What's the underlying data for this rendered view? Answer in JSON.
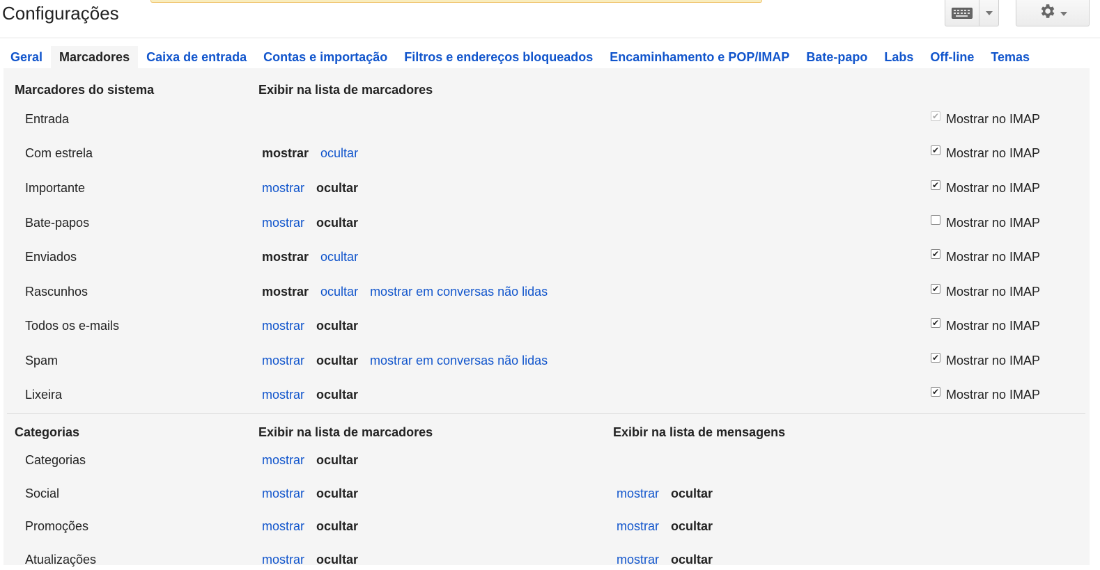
{
  "header": {
    "title": "Configurações"
  },
  "tabs": [
    {
      "label": "Geral",
      "active": false
    },
    {
      "label": "Marcadores",
      "active": true
    },
    {
      "label": "Caixa de entrada",
      "active": false
    },
    {
      "label": "Contas e importação",
      "active": false
    },
    {
      "label": "Filtros e endereços bloqueados",
      "active": false
    },
    {
      "label": "Encaminhamento e POP/IMAP",
      "active": false
    },
    {
      "label": "Bate-papo",
      "active": false
    },
    {
      "label": "Labs",
      "active": false
    },
    {
      "label": "Off-line",
      "active": false
    },
    {
      "label": "Temas",
      "active": false
    }
  ],
  "system": {
    "heading": "Marcadores do sistema",
    "col_heading": "Exibir na lista de marcadores",
    "show_label": "mostrar",
    "hide_label": "ocultar",
    "unread_label": "mostrar em conversas não lidas",
    "imap_label": "Mostrar no IMAP",
    "rows": [
      {
        "name": "Entrada",
        "state": null,
        "unread_option": false,
        "imap_checked": true,
        "imap_disabled": true
      },
      {
        "name": "Com estrela",
        "state": "mostrar",
        "unread_option": false,
        "imap_checked": true,
        "imap_disabled": false
      },
      {
        "name": "Importante",
        "state": "ocultar",
        "unread_option": false,
        "imap_checked": true,
        "imap_disabled": false
      },
      {
        "name": "Bate-papos",
        "state": "ocultar",
        "unread_option": false,
        "imap_checked": false,
        "imap_disabled": false
      },
      {
        "name": "Enviados",
        "state": "mostrar",
        "unread_option": false,
        "imap_checked": true,
        "imap_disabled": false
      },
      {
        "name": "Rascunhos",
        "state": "mostrar",
        "unread_option": true,
        "imap_checked": true,
        "imap_disabled": false
      },
      {
        "name": "Todos os e-mails",
        "state": "ocultar",
        "unread_option": false,
        "imap_checked": true,
        "imap_disabled": false
      },
      {
        "name": "Spam",
        "state": "ocultar",
        "unread_option": true,
        "imap_checked": true,
        "imap_disabled": false
      },
      {
        "name": "Lixeira",
        "state": "ocultar",
        "unread_option": false,
        "imap_checked": true,
        "imap_disabled": false
      }
    ]
  },
  "categories": {
    "heading": "Categorias",
    "col1_heading": "Exibir na lista de marcadores",
    "col2_heading": "Exibir na lista de mensagens",
    "rows": [
      {
        "name": "Categorias",
        "label_state": "ocultar",
        "msg_state": null
      },
      {
        "name": "Social",
        "label_state": "ocultar",
        "msg_state": "ocultar"
      },
      {
        "name": "Promoções",
        "label_state": "ocultar",
        "msg_state": "ocultar"
      },
      {
        "name": "Atualizações",
        "label_state": "ocultar",
        "msg_state": "ocultar"
      }
    ]
  },
  "icons": {
    "keyboard": "keyboard-icon",
    "dropdown": "chevron-down-icon",
    "settings": "gear-icon",
    "check": "checkbox-icon"
  },
  "colors": {
    "link": "#1155cc",
    "panel_bg": "#f5f5f5",
    "notice_bg": "#f9edbe"
  }
}
